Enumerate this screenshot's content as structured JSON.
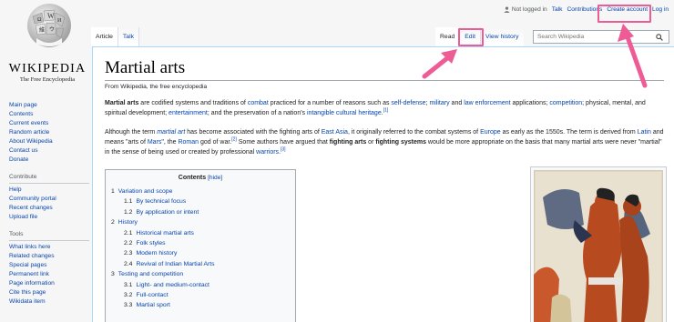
{
  "logo": {
    "wordmark": "WIKIPEDIA",
    "tagline": "The Free Encyclopedia"
  },
  "sidebar": {
    "nav": [
      "Main page",
      "Contents",
      "Current events",
      "Random article",
      "About Wikipedia",
      "Contact us",
      "Donate"
    ],
    "contribute_title": "Contribute",
    "contribute": [
      "Help",
      "Community portal",
      "Recent changes",
      "Upload file"
    ],
    "tools_title": "Tools",
    "tools": [
      "What links here",
      "Related changes",
      "Special pages",
      "Permanent link",
      "Page information",
      "Cite this page",
      "Wikidata item"
    ]
  },
  "personal": {
    "not_logged_in": "Not logged in",
    "talk": "Talk",
    "contributions": "Contributions",
    "create_account": "Create account",
    "log_in": "Log in"
  },
  "tabs": {
    "article": "Article",
    "talk": "Talk",
    "read": "Read",
    "edit": "Edit",
    "view_history": "View history"
  },
  "search": {
    "placeholder": "Search Wikipedia",
    "icon": "search-icon"
  },
  "article": {
    "title": "Martial arts",
    "site_sub": "From Wikipedia, the free encyclopedia",
    "p1": {
      "bold": "Martial arts",
      "t1": " are codified systems and traditions of ",
      "l1": "combat",
      "t2": " practiced for a number of reasons such as ",
      "l2": "self-defense",
      "t3": "; ",
      "l3": "military",
      "t4": " and ",
      "l4": "law enforcement",
      "t5": " applications; ",
      "l5": "competition",
      "t6": "; physical, mental, and spiritual development; ",
      "l6": "entertainment",
      "t7": "; and the preservation of a nation's ",
      "l7": "intangible cultural heritage",
      "t8": ".",
      "ref": "[1]"
    },
    "p2": {
      "t1": "Although the term ",
      "l1": "martial art",
      "t2": " has become associated with the fighting arts of ",
      "l2": "East Asia",
      "t3": ", it originally referred to the combat systems of ",
      "l3": "Europe",
      "t4": " as early as the 1550s. The term is derived from ",
      "l4": "Latin",
      "t5": " and means \"arts of ",
      "l5": "Mars",
      "t6": "\", the ",
      "l6": "Roman",
      "t7": " god of war.",
      "ref2": "[2]",
      "t8": " Some authors have argued that ",
      "b1": "fighting arts",
      "t9": " or ",
      "b2": "fighting systems",
      "t10": " would be more appropriate on the basis that many martial arts were never \"martial\" in the sense of being used or created by professional ",
      "l7": "warriors",
      "t11": ".",
      "ref3": "[3]"
    }
  },
  "toc": {
    "title": "Contents",
    "hide": "[hide]",
    "items": [
      {
        "num": "1",
        "text": "Variation and scope",
        "level": 1
      },
      {
        "num": "1.1",
        "text": "By technical focus",
        "level": 2
      },
      {
        "num": "1.2",
        "text": "By application or intent",
        "level": 2
      },
      {
        "num": "2",
        "text": "History",
        "level": 1
      },
      {
        "num": "2.1",
        "text": "Historical martial arts",
        "level": 2
      },
      {
        "num": "2.2",
        "text": "Folk styles",
        "level": 2
      },
      {
        "num": "2.3",
        "text": "Modern history",
        "level": 2
      },
      {
        "num": "2.4",
        "text": "Revival of Indian Martial Arts",
        "level": 2
      },
      {
        "num": "3",
        "text": "Testing and competition",
        "level": 1
      },
      {
        "num": "3.1",
        "text": "Light- and medium-contact",
        "level": 2
      },
      {
        "num": "3.2",
        "text": "Full-contact",
        "level": 2
      },
      {
        "num": "3.3",
        "text": "Martial sport",
        "level": 2
      }
    ]
  },
  "colors": {
    "annotation": "#ee5c96",
    "link": "#0645ad"
  }
}
